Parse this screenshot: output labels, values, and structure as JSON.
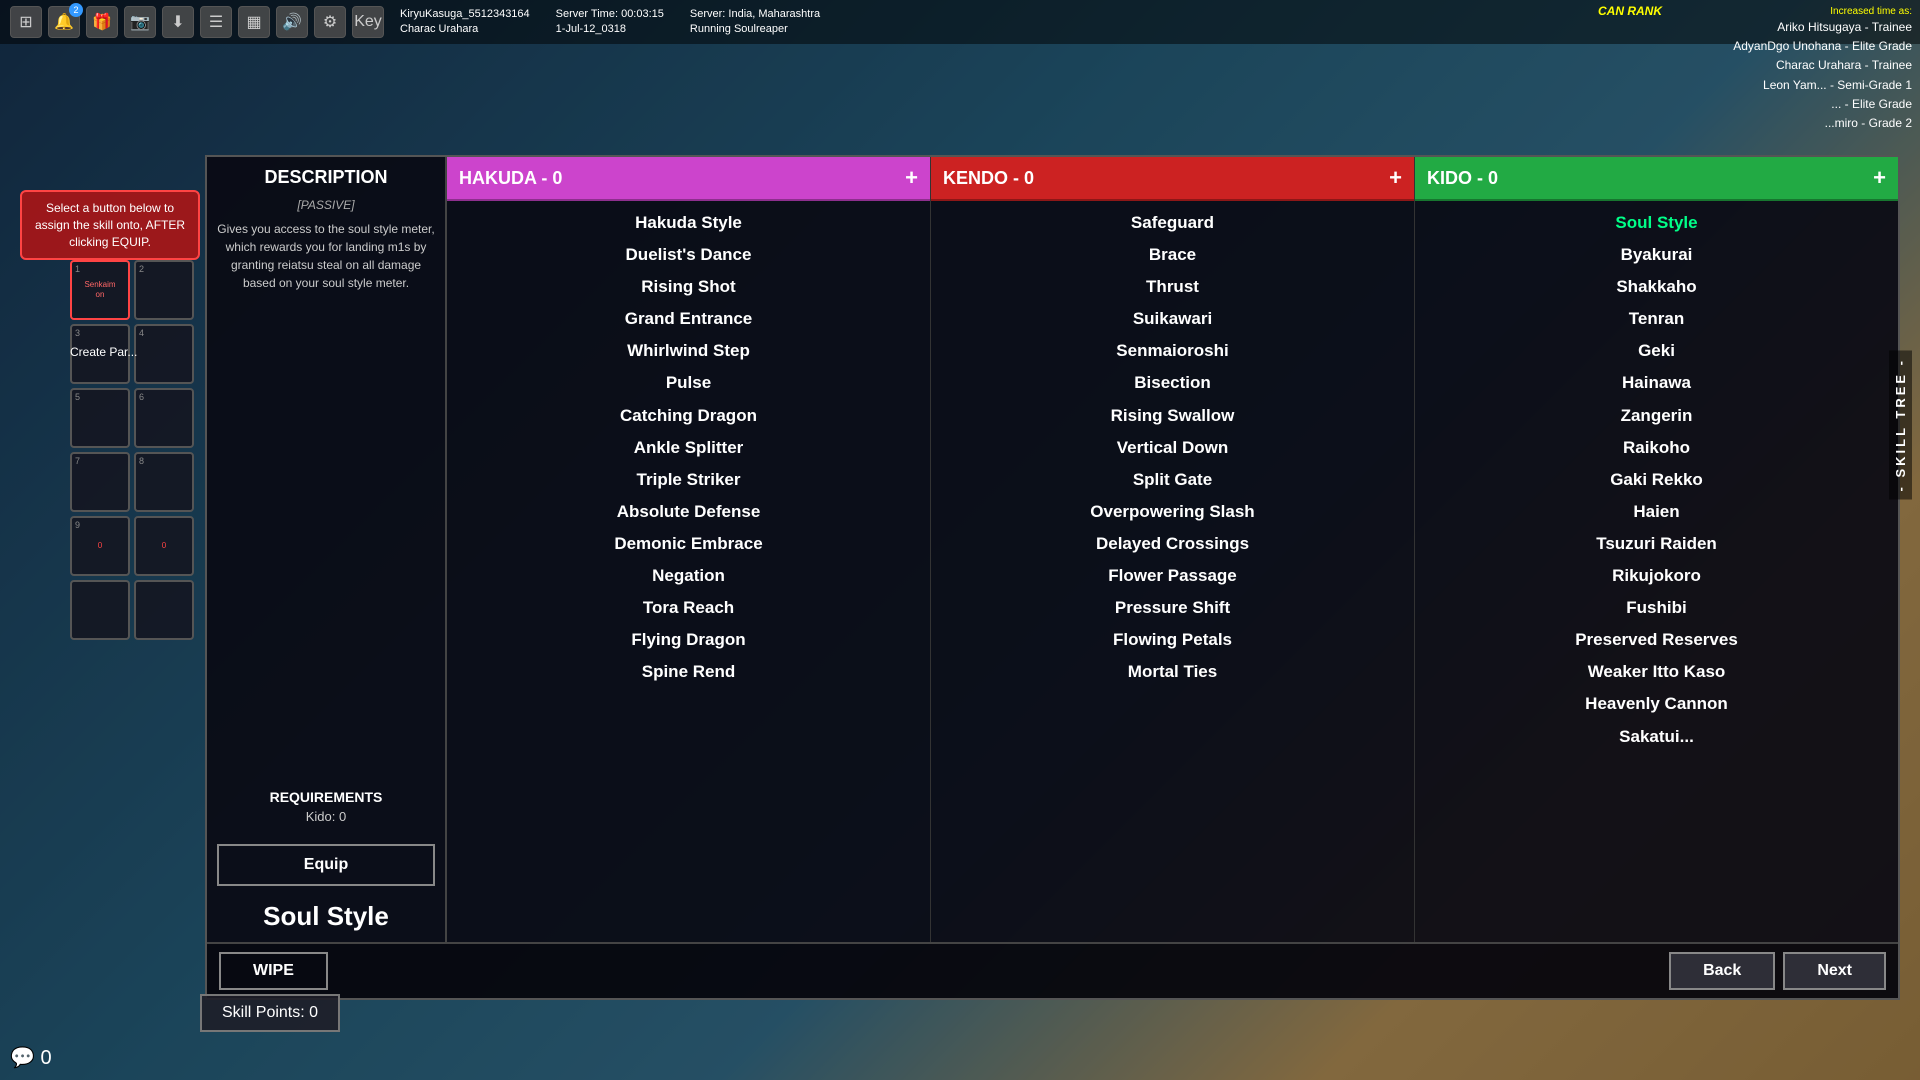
{
  "bg": {},
  "topHud": {
    "playerName": "KiryuKasuga_5512343164",
    "charName": "Charac Urahara",
    "serverTime": "Server Time: 00:03:15",
    "serverDate": "1-Jul-12_0318",
    "serverLocation": "Server: India, Maharashtra",
    "serverRole": "Running Soulreaper",
    "notifCount": "2"
  },
  "rankPanel": {
    "canRank": "CAN RANK",
    "increased": "Increased time as:",
    "ranks": [
      "Ariko Hitsugaya - Trainee",
      "AdyanDgo Unohana - Elite Grade",
      "Charac Urahara - Trainee",
      "Leon Yam... - Semi-Grade 1",
      "... - Elite Grade",
      "...miro - Grade 2"
    ]
  },
  "instruction": {
    "text": "Select a button below to assign the skill onto, AFTER clicking EQUIP."
  },
  "description": {
    "title": "DESCRIPTION",
    "passive": "[PASSIVE]",
    "text": "Gives you access to the soul style meter, which rewards you for landing m1s by granting reiatsu steal on all damage based on your soul style meter.",
    "requirements": "REQUIREMENTS",
    "kido": "Kido: 0",
    "equipLabel": "Equip",
    "skillName": "Soul Style"
  },
  "hakuda": {
    "header": "HAKUDA - 0",
    "plus": "+",
    "skills": [
      "Hakuda Style",
      "Duelist's Dance",
      "Rising Shot",
      "Grand Entrance",
      "Whirlwind Step",
      "Pulse",
      "Catching Dragon",
      "Ankle Splitter",
      "Triple Striker",
      "Absolute Defense",
      "Demonic Embrace",
      "Negation",
      "Tora Reach",
      "Flying Dragon",
      "Spine Rend"
    ]
  },
  "kendo": {
    "header": "KENDO - 0",
    "plus": "+",
    "skills": [
      "Safeguard",
      "Brace",
      "Thrust",
      "Suikawari",
      "Senmaioroshi",
      "Bisection",
      "Rising Swallow",
      "Vertical Down",
      "Split Gate",
      "Overpowering Slash",
      "Delayed Crossings",
      "Flower Passage",
      "Pressure Shift",
      "Flowing Petals",
      "Mortal Ties"
    ]
  },
  "kido": {
    "header": "KIDO - 0",
    "plus": "+",
    "skills": [
      "Soul Style",
      "Byakurai",
      "Shakkaho",
      "Tenran",
      "Geki",
      "Hainawa",
      "Zangerin",
      "Raikoho",
      "Gaki Rekko",
      "Haien",
      "Tsuzuri Raiden",
      "Rikujokoro",
      "Fushibi",
      "Preserved Reserves",
      "Weaker Itto Kaso",
      "Heavenly Cannon",
      "Sakatui..."
    ]
  },
  "bottomBar": {
    "wipeLabel": "WIPE",
    "backLabel": "Back",
    "nextLabel": "Next"
  },
  "skillPoints": {
    "label": "Skill Points: 0"
  },
  "skillTreeLabel": "- SKILL TREE -",
  "createParty": "Create Par...",
  "slots": [
    {
      "num": "1",
      "name": "Senkaim on"
    },
    {
      "num": "2",
      "name": ""
    },
    {
      "num": "3",
      "name": ""
    },
    {
      "num": "4",
      "name": ""
    },
    {
      "num": "5",
      "name": ""
    },
    {
      "num": "6",
      "name": ""
    },
    {
      "num": "7",
      "name": ""
    },
    {
      "num": "8",
      "name": ""
    },
    {
      "num": "9",
      "name": "0"
    },
    {
      "num": "",
      "name": "0"
    },
    {
      "num": "",
      "name": ""
    },
    {
      "num": "",
      "name": ""
    }
  ]
}
